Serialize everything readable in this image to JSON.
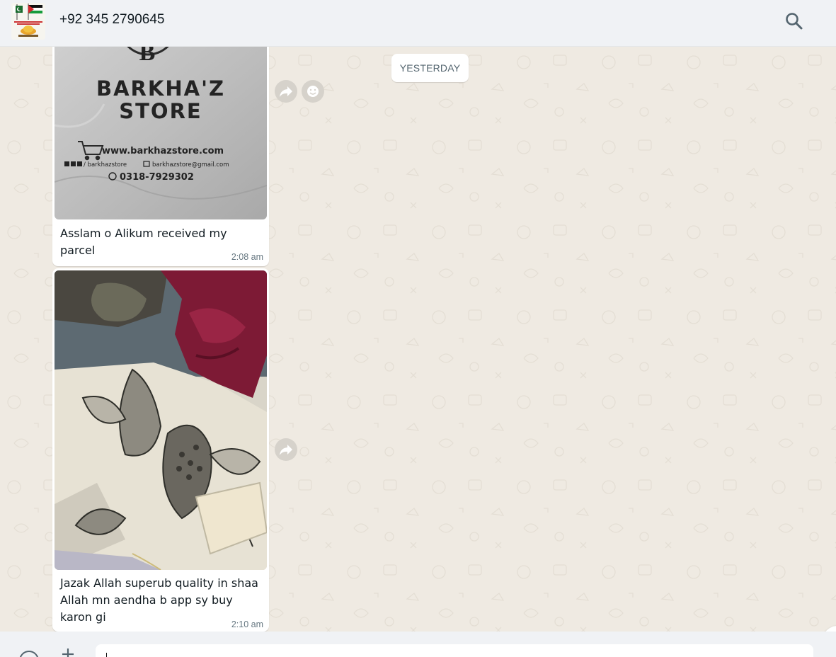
{
  "header": {
    "contact_name": "+92 345 2790645",
    "avatar_icon": "profile-flags-avatar",
    "search_icon": "search-icon"
  },
  "chat": {
    "date_separator": "YESTERDAY",
    "messages": [
      {
        "type": "image",
        "image_text": {
          "brand_line1": "BARKHA'Z",
          "brand_line2": "STORE",
          "logo_letter": "B",
          "website": "www.barkhazstore.com",
          "social": "/ barkhazstore",
          "email": "barkhazstore@gmail.com",
          "phone": "0318-7929302"
        },
        "caption": "Asslam o Alikum received my parcel",
        "time": "2:08 am",
        "actions": [
          "forward-icon",
          "emoji-react-icon"
        ]
      },
      {
        "type": "image",
        "image_description_icon": "fabric-photo",
        "caption": "Jazak Allah superub quality in shaa Allah mn aendha b app sy buy karon gi",
        "time": "2:10 am",
        "actions": [
          "forward-icon"
        ]
      }
    ]
  },
  "composer": {
    "input_value": "",
    "placeholder": "",
    "emoji_icon": "emoji-icon",
    "attach_icon": "plus-icon"
  },
  "colors": {
    "chat_background": "#efeae2",
    "header_background": "#f0f2f5",
    "bubble": "#ffffff",
    "timestamp": "#667781"
  }
}
